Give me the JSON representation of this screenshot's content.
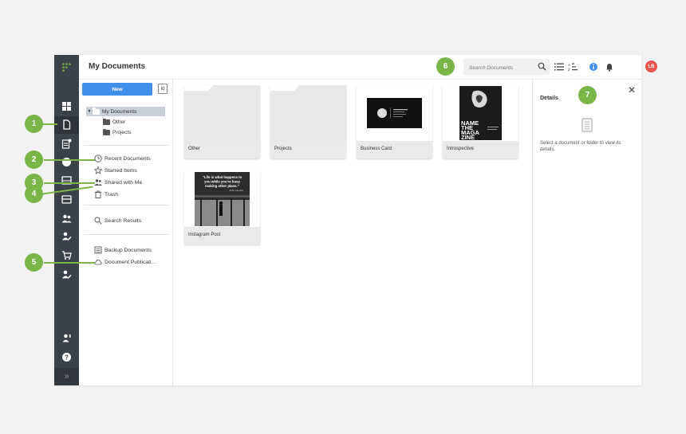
{
  "header": {
    "title": "My Documents",
    "search_placeholder": "Search Documents",
    "avatar_initials": "LB"
  },
  "sidebar": {
    "new_label": "New",
    "upload_label": "Id",
    "tree": {
      "root": "My Documents",
      "children": [
        "Other",
        "Projects"
      ]
    },
    "nav": [
      "Recent Documents",
      "Starred Items",
      "Shared with Me",
      "Trash"
    ],
    "search_results": "Search Results",
    "backup": "Backup Documents",
    "publication": "Document Publicati…"
  },
  "cards": [
    {
      "label": "Other",
      "kind": "folder"
    },
    {
      "label": "Projects",
      "kind": "folder"
    },
    {
      "label": "Business Card",
      "kind": "doc"
    },
    {
      "label": "Introspective",
      "kind": "doc"
    },
    {
      "label": "Instagram Post",
      "kind": "doc"
    }
  ],
  "thumbs": {
    "magazine": [
      "NAME",
      "THE",
      "MAGA",
      "ZINE"
    ],
    "quote": [
      "\"Life is what happens to",
      "you while you're busy",
      "making other plans.\""
    ],
    "quote_author": "John Lennon"
  },
  "details": {
    "title": "Details",
    "message": "Select a document or folder to view its details."
  },
  "callouts": [
    "1",
    "2",
    "3",
    "4",
    "5",
    "6",
    "7"
  ],
  "colors": {
    "accent": "#3f8eea",
    "callout": "#79b547",
    "rail": "#3b4148",
    "avatar": "#e8544e"
  }
}
